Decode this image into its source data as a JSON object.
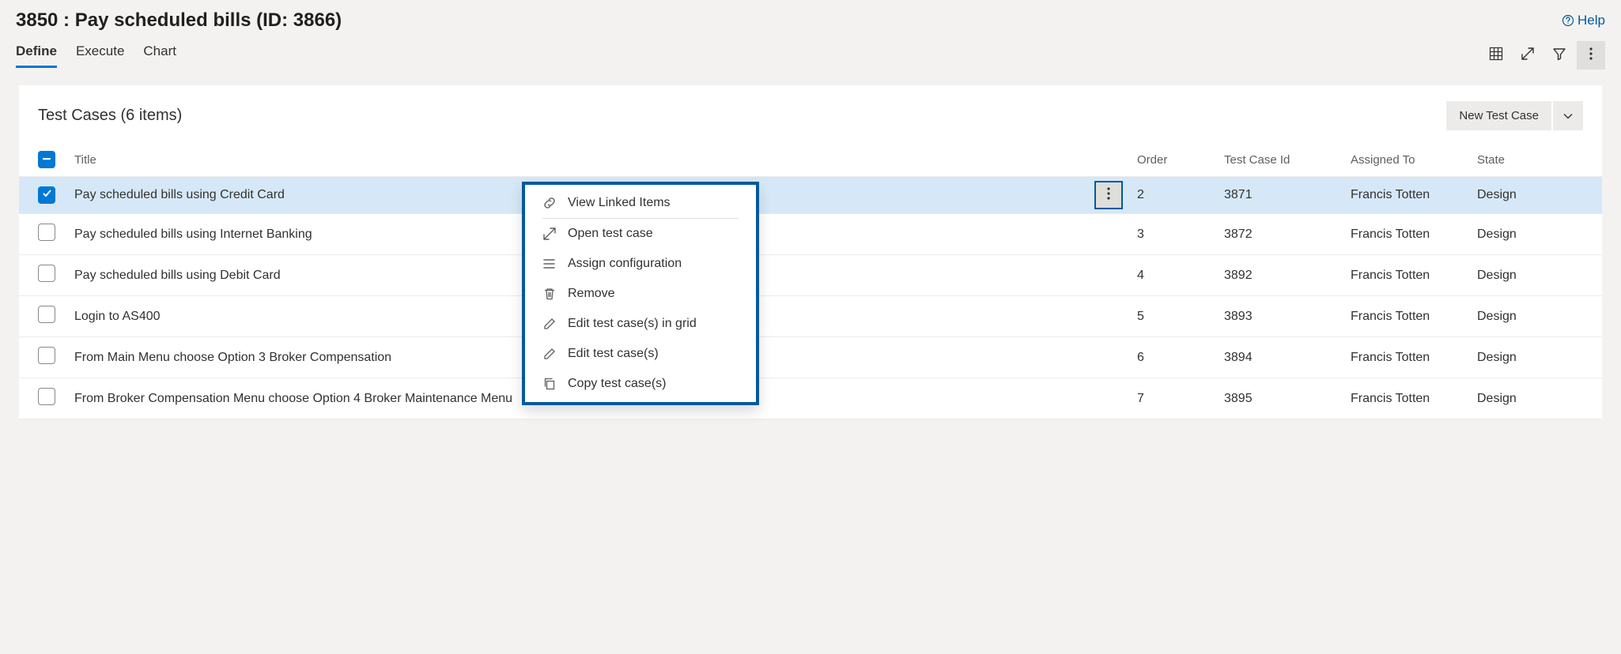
{
  "page": {
    "title": "3850 : Pay scheduled bills (ID: 3866)",
    "help_label": "Help"
  },
  "tabs": [
    {
      "label": "Define",
      "active": true
    },
    {
      "label": "Execute",
      "active": false
    },
    {
      "label": "Chart",
      "active": false
    }
  ],
  "panel": {
    "title": "Test Cases (6 items)",
    "new_button": "New Test Case"
  },
  "columns": {
    "title": "Title",
    "order": "Order",
    "test_case_id": "Test Case Id",
    "assigned_to": "Assigned To",
    "state": "State"
  },
  "rows": [
    {
      "selected": true,
      "title": "Pay scheduled bills using Credit Card",
      "order": "2",
      "test_case_id": "3871",
      "assigned_to": "Francis Totten",
      "state": "Design",
      "show_more": true
    },
    {
      "selected": false,
      "title": "Pay scheduled bills using Internet Banking",
      "order": "3",
      "test_case_id": "3872",
      "assigned_to": "Francis Totten",
      "state": "Design",
      "show_more": false
    },
    {
      "selected": false,
      "title": "Pay scheduled bills using Debit Card",
      "order": "4",
      "test_case_id": "3892",
      "assigned_to": "Francis Totten",
      "state": "Design",
      "show_more": false
    },
    {
      "selected": false,
      "title": "Login to AS400",
      "order": "5",
      "test_case_id": "3893",
      "assigned_to": "Francis Totten",
      "state": "Design",
      "show_more": false
    },
    {
      "selected": false,
      "title": "From Main Menu choose Option 3 Broker Compensation",
      "order": "6",
      "test_case_id": "3894",
      "assigned_to": "Francis Totten",
      "state": "Design",
      "show_more": false
    },
    {
      "selected": false,
      "title": "From Broker Compensation Menu choose Option 4 Broker Maintenance Menu",
      "order": "7",
      "test_case_id": "3895",
      "assigned_to": "Francis Totten",
      "state": "Design",
      "show_more": false
    }
  ],
  "context_menu": {
    "items": [
      {
        "icon": "link",
        "label": "View Linked Items"
      },
      {
        "sep": true
      },
      {
        "icon": "open",
        "label": "Open test case"
      },
      {
        "icon": "assign",
        "label": "Assign configuration"
      },
      {
        "icon": "trash",
        "label": "Remove"
      },
      {
        "icon": "pencil",
        "label": "Edit test case(s) in grid"
      },
      {
        "icon": "pencil",
        "label": "Edit test case(s)"
      },
      {
        "icon": "copy",
        "label": "Copy test case(s)"
      }
    ]
  }
}
